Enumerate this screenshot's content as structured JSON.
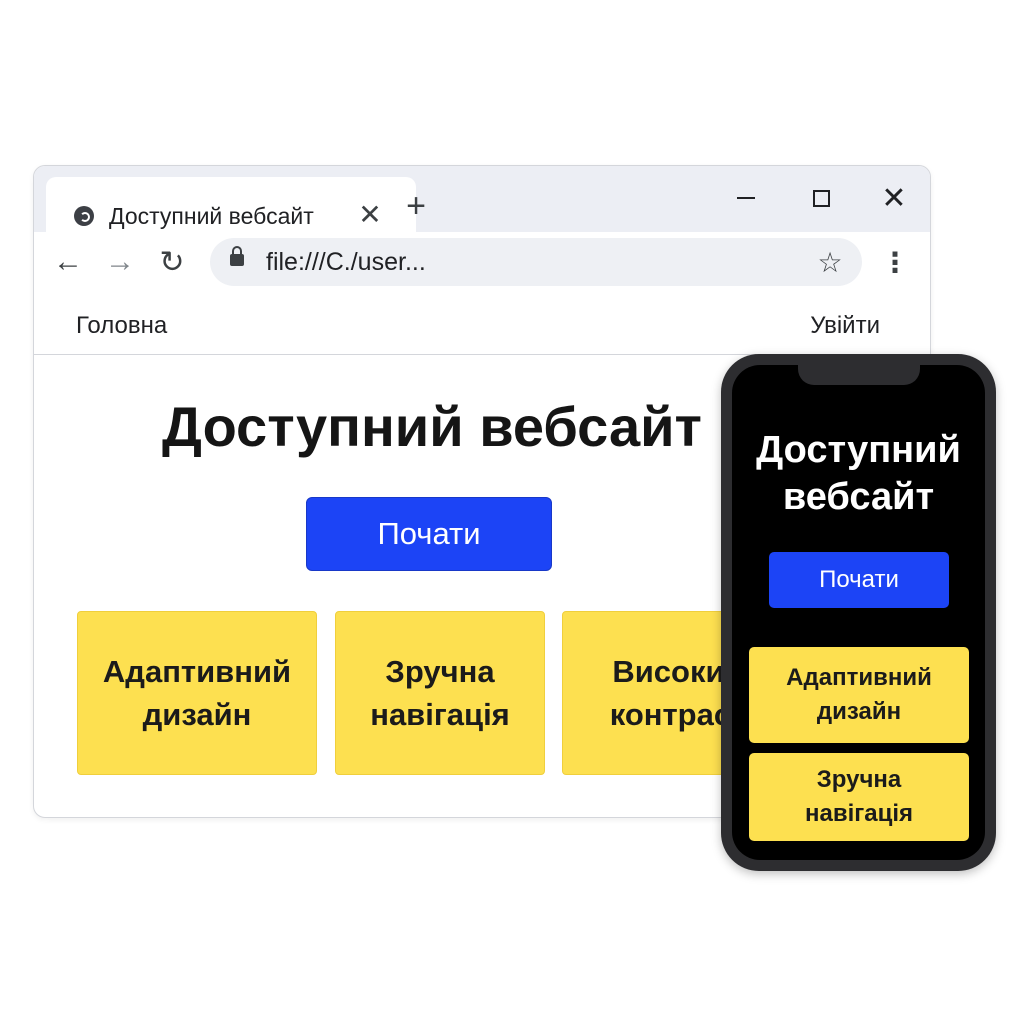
{
  "browser": {
    "tab_title": "Доступний вебсайт",
    "tab_close_glyph": "✕",
    "new_tab_glyph": "+",
    "window_close_glyph": "✕",
    "address": "file:///C./user...",
    "back_glyph": "←",
    "forward_glyph": "→",
    "reload_glyph": "↻",
    "star_glyph": "☆",
    "menu_glyph": "⋮"
  },
  "site": {
    "nav": {
      "home": "Головна",
      "login": "Увійти"
    },
    "title": "Доступний вебсайт",
    "cta": "Почати",
    "cards": [
      {
        "line1": "Адаптивний",
        "line2": "дизайн"
      },
      {
        "line1": "Зручна",
        "line2": "навігація"
      },
      {
        "line1": "Високий",
        "line2": "контраст"
      }
    ]
  },
  "phone": {
    "title_line1": "Доступний",
    "title_line2": "вебсайт",
    "cta": "Почати",
    "cards": [
      {
        "line1": "Адаптивний",
        "line2": "дизайн"
      },
      {
        "line1": "Зручна",
        "line2": "навігація"
      }
    ]
  },
  "colors": {
    "accent_blue": "#1c44f6",
    "card_yellow": "#fde050",
    "phone_bg": "#000000",
    "phone_frame": "#2d2d30"
  },
  "icons": [
    "favicon-icon",
    "close-icon",
    "plus-icon",
    "minimize-icon",
    "maximize-icon",
    "back-arrow-icon",
    "forward-arrow-icon",
    "reload-icon",
    "lock-icon",
    "star-icon",
    "kebab-menu-icon"
  ]
}
